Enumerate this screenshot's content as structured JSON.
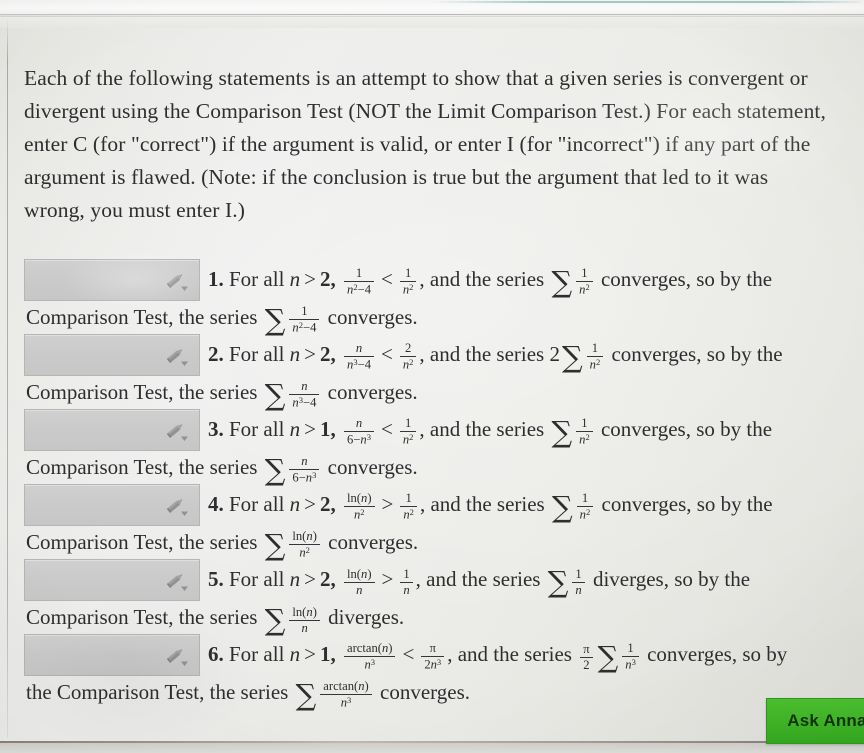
{
  "instructions": "Each of the following statements is an attempt to show that a given series is convergent or divergent using the Comparison Test (NOT the Limit Comparison Test.) For each statement, enter C (for \"correct\") if the argument is valid, or enter I (for \"incorrect\") if any part of the argument is flawed. (Note: if the conclusion is true but the argument that led to it was wrong, you must enter I.)",
  "answer_input": {
    "value": "",
    "placeholder": "",
    "icon": "pencil-icon",
    "dropdown_icon": "chevron-down-icon"
  },
  "buttons": {
    "ask_anna": "Ask Anna"
  },
  "colors": {
    "page_background": "#e7e7e2",
    "text": "#2e2e30",
    "input_fill": "#c9cac9",
    "input_border": "#b4b5b4",
    "ask_anna_green": "#3fb527",
    "bezel_teal": "#8fc0ba"
  },
  "items": [
    {
      "number": "1.",
      "line1": {
        "prefix": "For all ",
        "var": "n",
        "rel": ">",
        "bound": "2,",
        "lhs_num": "1",
        "lhs_den_base": "n",
        "lhs_den_exp": "2",
        "lhs_den_tail": "−4",
        "inequality": "<",
        "rhs_num": "1",
        "rhs_den_base": "n",
        "rhs_den_exp": "2",
        "rhs_den_tail": "",
        "mid": ", and the series ",
        "series_coef": "",
        "series_num": "1",
        "series_den_base": "n",
        "series_den_exp": "2",
        "series_den_tail": "",
        "verb": "converges",
        "suffix": ", so by the"
      },
      "line2": {
        "prefix": "Comparison Test, the series ",
        "num": "1",
        "den_base": "n",
        "den_exp": "2",
        "den_tail": "−4",
        "verb": "converges."
      }
    },
    {
      "number": "2.",
      "line1": {
        "prefix": "For all ",
        "var": "n",
        "rel": ">",
        "bound": "2,",
        "lhs_num": "n",
        "lhs_den_base": "n",
        "lhs_den_exp": "3",
        "lhs_den_tail": "−4",
        "inequality": "<",
        "rhs_num": "2",
        "rhs_den_base": "n",
        "rhs_den_exp": "2",
        "rhs_den_tail": "",
        "mid": ", and the series ",
        "series_coef": "2",
        "series_num": "1",
        "series_den_base": "n",
        "series_den_exp": "2",
        "series_den_tail": "",
        "verb": "converges",
        "suffix": ", so by the"
      },
      "line2": {
        "prefix": "Comparison Test, the series ",
        "num": "n",
        "den_base": "n",
        "den_exp": "3",
        "den_tail": "−4",
        "verb": "converges."
      }
    },
    {
      "number": "3.",
      "line1": {
        "prefix": "For all ",
        "var": "n",
        "rel": ">",
        "bound": "1,",
        "lhs_num": "n",
        "lhs_den_base": "6−n",
        "lhs_den_exp": "3",
        "lhs_den_tail": "",
        "inequality": "<",
        "rhs_num": "1",
        "rhs_den_base": "n",
        "rhs_den_exp": "2",
        "rhs_den_tail": "",
        "mid": ", and the series ",
        "series_coef": "",
        "series_num": "1",
        "series_den_base": "n",
        "series_den_exp": "2",
        "series_den_tail": "",
        "verb": "converges",
        "suffix": ", so by the"
      },
      "line2": {
        "prefix": "Comparison Test, the series ",
        "num": "n",
        "den_base": "6−n",
        "den_exp": "3",
        "den_tail": "",
        "verb": "converges."
      }
    },
    {
      "number": "4.",
      "line1": {
        "prefix": "For all ",
        "var": "n",
        "rel": ">",
        "bound": "2,",
        "lhs_num": "ln(n)",
        "lhs_den_base": "n",
        "lhs_den_exp": "2",
        "lhs_den_tail": "",
        "inequality": ">",
        "rhs_num": "1",
        "rhs_den_base": "n",
        "rhs_den_exp": "2",
        "rhs_den_tail": "",
        "mid": ", and the series ",
        "series_coef": "",
        "series_num": "1",
        "series_den_base": "n",
        "series_den_exp": "2",
        "series_den_tail": "",
        "verb": "converges",
        "suffix": ", so by the"
      },
      "line2": {
        "prefix": "Comparison Test, the series ",
        "num": "ln(n)",
        "den_base": "n",
        "den_exp": "2",
        "den_tail": "",
        "verb": "converges."
      }
    },
    {
      "number": "5.",
      "line1": {
        "prefix": "For all ",
        "var": "n",
        "rel": ">",
        "bound": "2,",
        "lhs_num": "ln(n)",
        "lhs_den_base": "n",
        "lhs_den_exp": "",
        "lhs_den_tail": "",
        "inequality": ">",
        "rhs_num": "1",
        "rhs_den_base": "n",
        "rhs_den_exp": "",
        "rhs_den_tail": "",
        "mid": ", and the series ",
        "series_coef": "",
        "series_num": "1",
        "series_den_base": "n",
        "series_den_exp": "",
        "series_den_tail": "",
        "verb": "diverges",
        "suffix": ", so by the"
      },
      "line2": {
        "prefix": "Comparison Test, the series ",
        "num": "ln(n)",
        "den_base": "n",
        "den_exp": "",
        "den_tail": "",
        "verb": "diverges."
      }
    },
    {
      "number": "6.",
      "line1": {
        "prefix": "For all ",
        "var": "n",
        "rel": ">",
        "bound": "1,",
        "lhs_num": "arctan(n)",
        "lhs_den_base": "n",
        "lhs_den_exp": "3",
        "lhs_den_tail": "",
        "inequality": "<",
        "rhs_num": "π",
        "rhs_den_base": "2n",
        "rhs_den_exp": "3",
        "rhs_den_tail": "",
        "mid": ", and the series ",
        "series_coef": "pi/2",
        "series_num": "1",
        "series_den_base": "n",
        "series_den_exp": "3",
        "series_den_tail": "",
        "verb": "converges",
        "suffix": ", so by"
      },
      "line2": {
        "prefix": "the Comparison Test, the series ",
        "num": "arctan(n)",
        "den_base": "n",
        "den_exp": "3",
        "den_tail": "",
        "verb": "converges."
      }
    }
  ]
}
